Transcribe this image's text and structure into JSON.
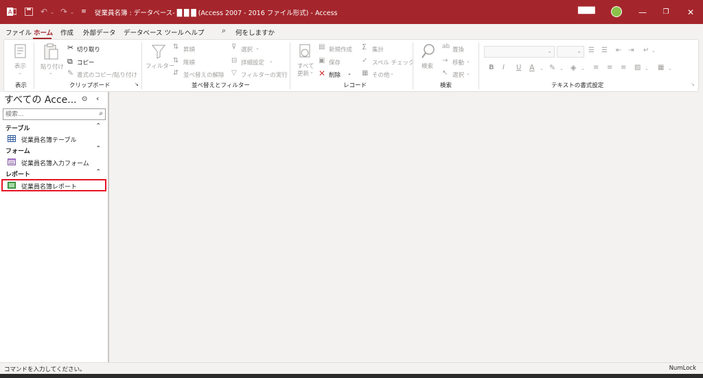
{
  "titlebar": {
    "title": "従業員名簿 : データベース- █ █ █ (Access 2007 - 2016 ファイル形式)  -  Access",
    "app_icon": "access-icon",
    "save_icon": "save-icon",
    "undo_icon": "undo-icon",
    "redo_icon": "redo-icon",
    "qat_icon": "customize-icon",
    "user_name": "████",
    "minimize": "—",
    "restore": "❐",
    "close": "✕"
  },
  "menu": {
    "items": [
      "ファイル",
      "ホーム",
      "作成",
      "外部データ",
      "データベース ツール",
      "ヘルプ"
    ],
    "search_icon": "⌕",
    "search_label": "何をしますか"
  },
  "ribbon": {
    "view": {
      "label": "表示",
      "group": "表示"
    },
    "clipboard": {
      "paste": "貼り付け",
      "cut": "切り取り",
      "copy": "コピー",
      "format_painter": "書式のコピー/貼り付け",
      "group": "クリップボード"
    },
    "sort_filter": {
      "filter": "フィルター",
      "ascending": "昇順",
      "descending": "降順",
      "remove_sort": "並べ替えの解除",
      "selection": "選択",
      "advanced": "詳細設定",
      "toggle_filter": "フィルターの実行",
      "group": "並べ替えとフィルター"
    },
    "records": {
      "refresh_line1": "すべて",
      "refresh_line2": "更新",
      "new": "新規作成",
      "save": "保存",
      "delete": "削除",
      "totals": "集計",
      "spelling": "スペル チェック",
      "more": "その他",
      "group": "レコード"
    },
    "find": {
      "find": "検索",
      "replace": "置換",
      "goto": "移動",
      "select": "選択",
      "group": "検索"
    },
    "text_format": {
      "bold": "B",
      "italic": "I",
      "underline": "U",
      "group": "テキストの書式設定"
    }
  },
  "nav": {
    "title": "すべての Acce...",
    "search_placeholder": "検索...",
    "categories": [
      {
        "label": "テーブル",
        "items": [
          "従業員名簿テーブル"
        ]
      },
      {
        "label": "フォーム",
        "items": [
          "従業員名簿入力フォーム"
        ]
      },
      {
        "label": "レポート",
        "items": [
          "従業員名簿レポート"
        ]
      }
    ]
  },
  "status": {
    "left": "コマンドを入力してください。",
    "right": "NumLock"
  },
  "colors": {
    "accent": "#a4262c",
    "highlight": "#e81123"
  }
}
